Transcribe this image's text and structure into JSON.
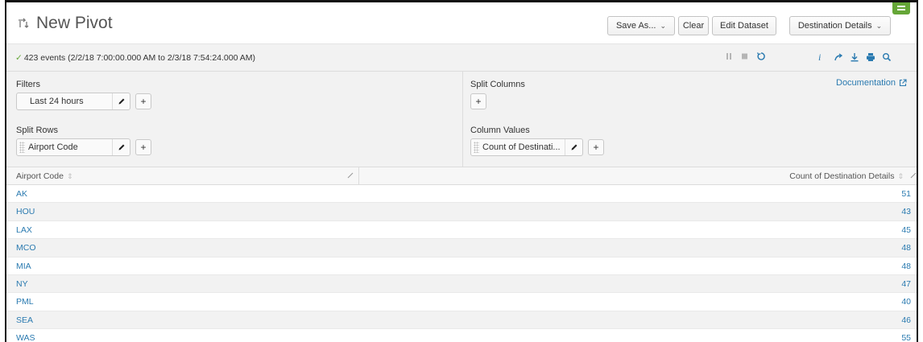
{
  "header": {
    "title": "New Pivot",
    "save_as": "Save As...",
    "clear": "Clear",
    "edit_dataset": "Edit Dataset",
    "dataset_name": "Destination Details"
  },
  "status": {
    "check": "✓",
    "events_text": "423 events (2/2/18 7:00:00.000 AM to 2/3/18 7:54:24.000 AM)"
  },
  "config": {
    "filters_label": "Filters",
    "filter_value": "Last 24 hours",
    "split_rows_label": "Split Rows",
    "split_row_value": "Airport Code",
    "split_columns_label": "Split Columns",
    "column_values_label": "Column Values",
    "column_value": "Count of Destinati...",
    "documentation": "Documentation",
    "add": "+"
  },
  "table": {
    "columns": [
      "Airport Code",
      "Count of Destination Details"
    ],
    "rows": [
      {
        "code": "AK",
        "count": "51"
      },
      {
        "code": "HOU",
        "count": "43"
      },
      {
        "code": "LAX",
        "count": "45"
      },
      {
        "code": "MCO",
        "count": "48"
      },
      {
        "code": "MIA",
        "count": "48"
      },
      {
        "code": "NY",
        "count": "47"
      },
      {
        "code": "PML",
        "count": "40"
      },
      {
        "code": "SEA",
        "count": "46"
      },
      {
        "code": "WAS",
        "count": "55"
      }
    ]
  },
  "colors": {
    "link": "#2a7ab0",
    "success": "#65a637",
    "panel_bg": "#f2f2f2"
  },
  "icons": {
    "title": "pivot-icon",
    "pause": "pause-icon",
    "stop": "stop-icon",
    "refresh": "refresh-icon",
    "info": "info-icon",
    "share": "share-icon",
    "export": "download-icon",
    "print": "print-icon",
    "inspect": "search-icon",
    "edit": "pencil-icon",
    "external": "external-link-icon",
    "menu": "menu-icon"
  }
}
